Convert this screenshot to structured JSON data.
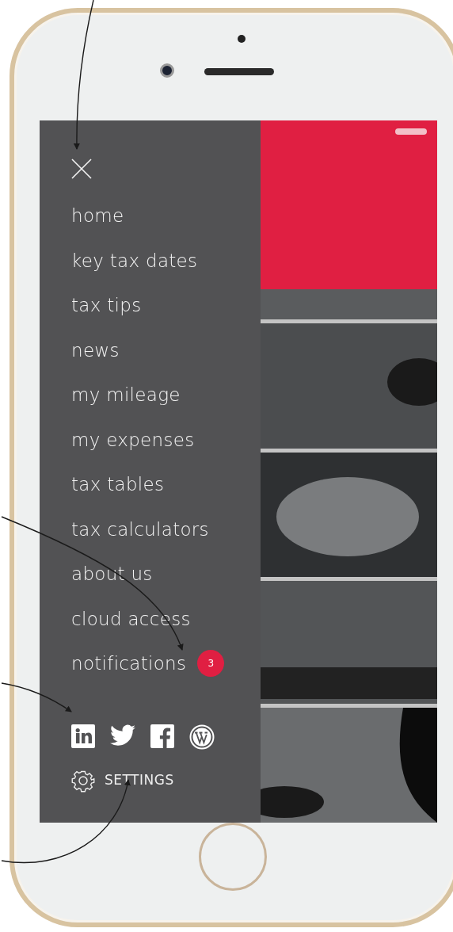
{
  "menu": {
    "items": [
      {
        "label": "home"
      },
      {
        "label": "key tax dates"
      },
      {
        "label": "tax tips"
      },
      {
        "label": "news"
      },
      {
        "label": "my mileage"
      },
      {
        "label": "my expenses"
      },
      {
        "label": "tax tables"
      },
      {
        "label": "tax calculators"
      },
      {
        "label": "about us"
      },
      {
        "label": "cloud access"
      },
      {
        "label": "notifications",
        "badge": "3"
      }
    ]
  },
  "settings": {
    "label": "SETTINGS"
  }
}
